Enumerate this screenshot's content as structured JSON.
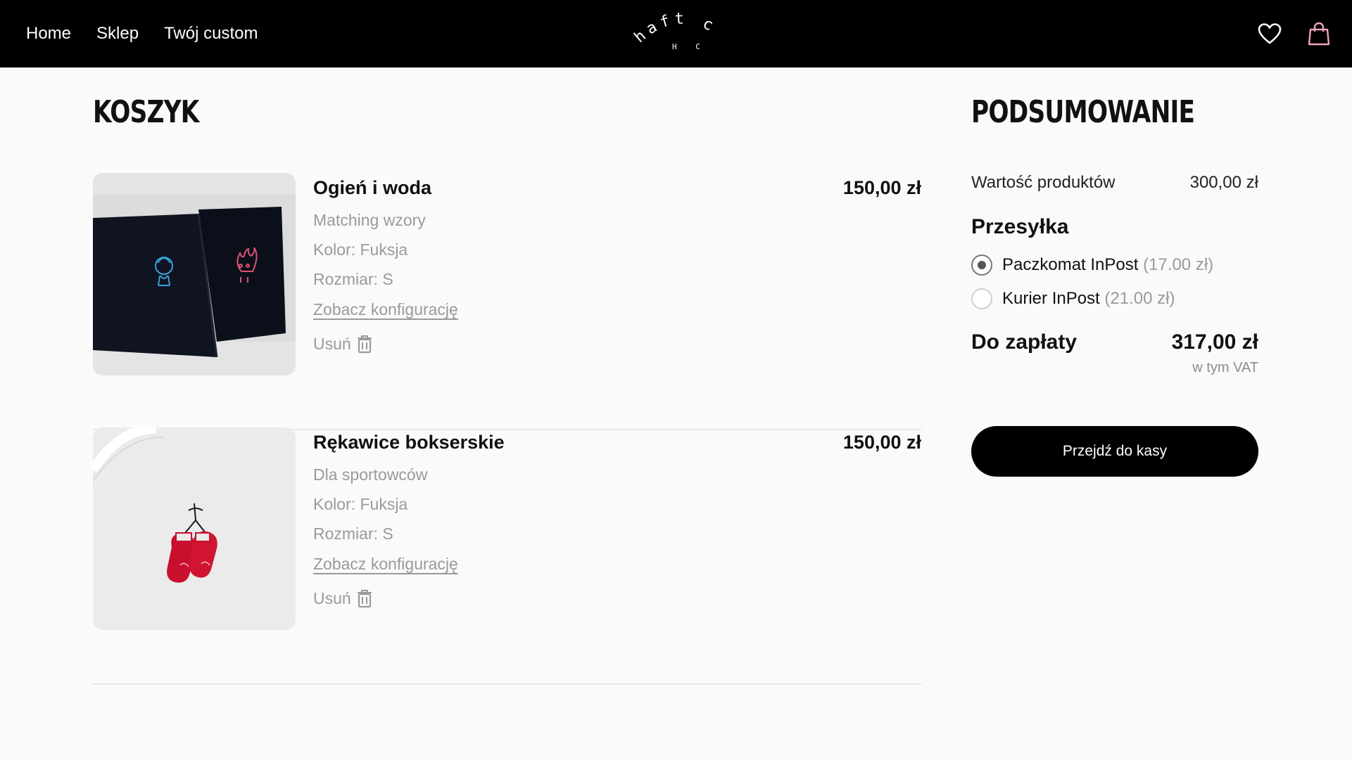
{
  "nav": {
    "links": [
      "Home",
      "Sklep",
      "Twój custom"
    ],
    "logo_text": "haft club",
    "logo_sub": "H C",
    "icons": [
      "heart-icon",
      "shopping-bag-icon"
    ]
  },
  "cart": {
    "title": "KOSZYK",
    "items": [
      {
        "name": "Ogień i woda",
        "subtitle": "Matching wzory",
        "color": "Kolor: Fuksja",
        "size": "Rozmiar: S",
        "config_link": "Zobacz konfigurację",
        "remove_label": "Usuń",
        "price": "150,00 zł"
      },
      {
        "name": "Rękawice bokserskie",
        "subtitle": "Dla sportowców",
        "color": "Kolor: Fuksja",
        "size": "Rozmiar: S",
        "config_link": "Zobacz konfigurację",
        "remove_label": "Usuń",
        "price": "150,00 zł"
      }
    ]
  },
  "summary": {
    "title": "PODSUMOWANIE",
    "products_label": "Wartość produktów",
    "products_value": "300,00 zł",
    "shipping_title": "Przesyłka",
    "shipping_options": [
      {
        "label": "Paczkomat InPost",
        "price": "(17.00 zł)",
        "selected": true
      },
      {
        "label": "Kurier InPost",
        "price": "(21.00 zł)",
        "selected": false
      }
    ],
    "total_label": "Do zapłaty",
    "total_value": "317,00 zł",
    "vat_note": "w tym VAT",
    "checkout_label": "Przejdź do kasy"
  },
  "colors": {
    "nav_bg": "#000000",
    "page_bg": "#fafafa",
    "muted_text": "#9a9a9a",
    "button_bg": "#000000"
  }
}
